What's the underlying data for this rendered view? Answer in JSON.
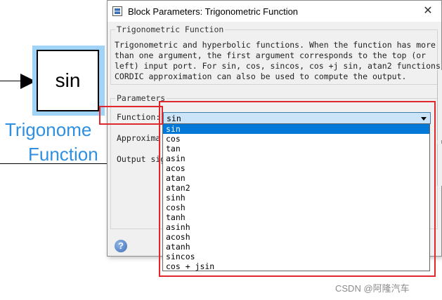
{
  "canvas": {
    "block_label": "sin",
    "caption_line1": "Trigonome",
    "caption_line2": "Function"
  },
  "dialog": {
    "title": "Block Parameters: Trigonometric Function",
    "close_symbol": "✕",
    "description_group": {
      "title": "Trigonometric Function",
      "text": "Trigonometric and hyperbolic functions. When the function has more\nthan one argument, the first argument corresponds to the top (or\nleft) input port. For sin, cos, sincos, cos +j sin, atan2 functions,\nCORDIC approximation can also be used to compute the output."
    },
    "parameters_group": {
      "title": "Parameters",
      "function_label": "Function:",
      "approximation_label": "Approxima",
      "output_signal_label": "Output sig",
      "function_value": "sin",
      "function_options": [
        "sin",
        "cos",
        "tan",
        "asin",
        "acos",
        "atan",
        "atan2",
        "sinh",
        "cosh",
        "tanh",
        "asinh",
        "acosh",
        "atanh",
        "sincos",
        "cos + jsin"
      ],
      "selected_option": "sin"
    },
    "help_symbol": "?"
  },
  "watermark": "CSDN @阿隆汽车",
  "colors": {
    "highlight_red": "#e0282c",
    "selection_blue": "#0078d7",
    "caption_blue": "#2f8fe0",
    "block_highlight": "#9fd3f7"
  }
}
